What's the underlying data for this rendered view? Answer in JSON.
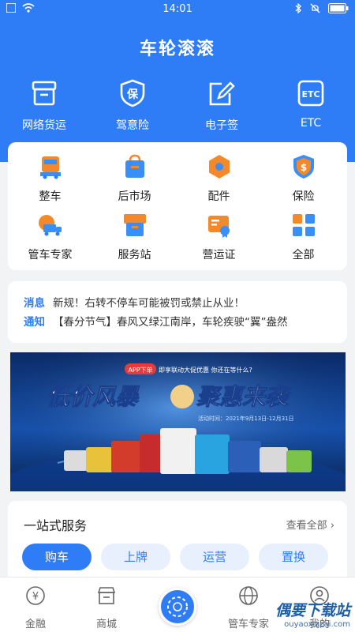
{
  "status_bar": {
    "time": "14:01"
  },
  "header": {
    "title": "车轮滚滚"
  },
  "quick_services": [
    {
      "label": "网络货运",
      "icon": "archive-box-icon"
    },
    {
      "label": "驾意险",
      "icon": "insurance-shield-icon"
    },
    {
      "label": "电子签",
      "icon": "sign-pen-icon"
    },
    {
      "label": "ETC",
      "icon": "etc-icon"
    }
  ],
  "service_grid": [
    {
      "label": "整车",
      "icon": "truck-icon"
    },
    {
      "label": "后市场",
      "icon": "shopping-bag-icon"
    },
    {
      "label": "配件",
      "icon": "hex-part-icon"
    },
    {
      "label": "保险",
      "icon": "yen-shield-icon"
    },
    {
      "label": "管车专家",
      "icon": "truck-globe-icon"
    },
    {
      "label": "服务站",
      "icon": "service-box-icon"
    },
    {
      "label": "营运证",
      "icon": "certificate-icon"
    },
    {
      "label": "全部",
      "icon": "all-grid-icon"
    }
  ],
  "messages": [
    {
      "tag": "消息",
      "text": "新规！右转不停车可能被罚或禁止从业！"
    },
    {
      "tag": "通知",
      "text": "【春分节气】春风又绿江南岸，车轮疾驶“翼”盎然"
    }
  ],
  "banner": {
    "badge": "APP下单",
    "subtitle": "即享联动大促优惠  你还在等什么?",
    "headline_left": "低价风暴",
    "headline_right": "聚惠来袭",
    "dates": "活动时间：2021年9月13日-12月31日"
  },
  "one_stop": {
    "title": "一站式服务",
    "more": "查看全部",
    "pills": [
      "购车",
      "上牌",
      "运营",
      "置换"
    ]
  },
  "tabbar": [
    {
      "label": "金融",
      "icon": "yen-circle-icon"
    },
    {
      "label": "商城",
      "icon": "store-icon"
    },
    {
      "label": "管车专家",
      "icon": "globe-icon"
    },
    {
      "label": "我的",
      "icon": "user-icon"
    }
  ],
  "watermark": {
    "line1": "偶要下载站",
    "line2": "ouyaoxiazai.com"
  },
  "colors": {
    "primary": "#2f7df6",
    "orange": "#f5892a",
    "background": "#f2f3f5"
  }
}
